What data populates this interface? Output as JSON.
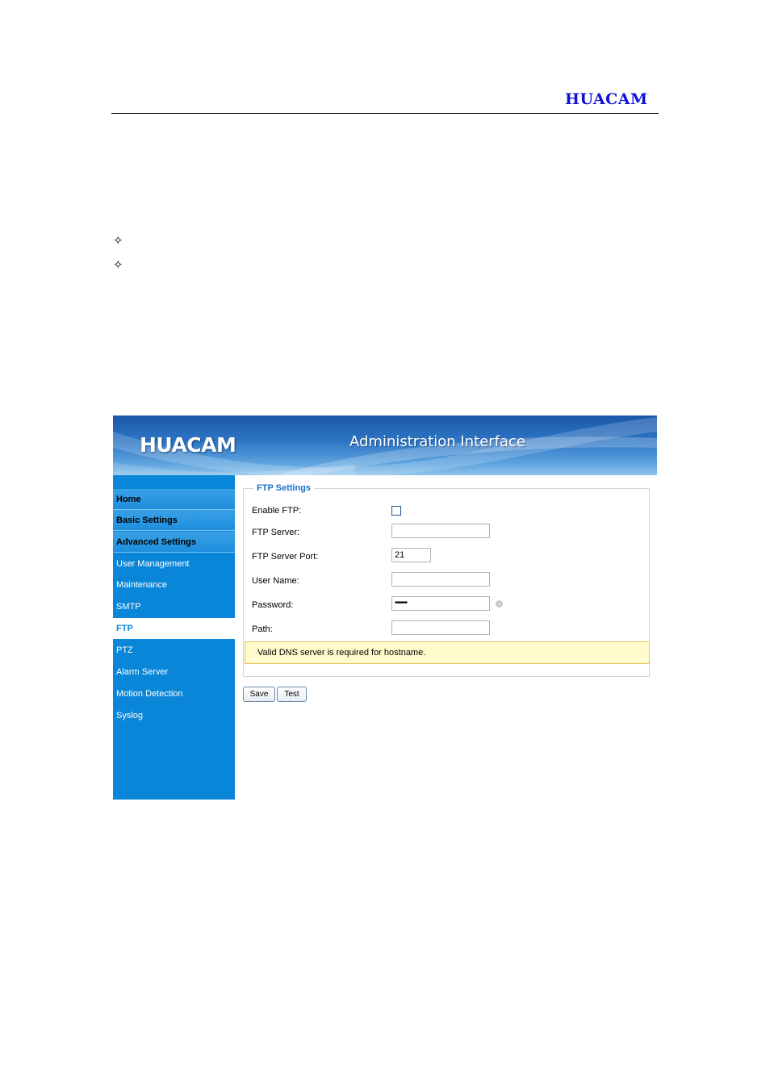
{
  "document": {
    "logo": "HUACAM",
    "bullets": [
      "✧",
      "✧"
    ]
  },
  "banner": {
    "brand": "HUACAM",
    "title": "Administration Interface"
  },
  "sidebar": {
    "items": [
      {
        "label": "Home"
      },
      {
        "label": "Basic Settings"
      },
      {
        "label": "Advanced Settings"
      },
      {
        "label": "User Management"
      },
      {
        "label": "Maintenance"
      },
      {
        "label": "SMTP"
      },
      {
        "label": "FTP"
      },
      {
        "label": "PTZ"
      },
      {
        "label": "Alarm Server"
      },
      {
        "label": "Motion Detection"
      },
      {
        "label": "Syslog"
      }
    ]
  },
  "ftp": {
    "legend": "FTP Settings",
    "enable_label": "Enable FTP:",
    "enable_checked": false,
    "server_label": "FTP Server:",
    "server_value": "",
    "port_label": "FTP Server Port:",
    "port_value": "21",
    "username_label": "User Name:",
    "username_value": "",
    "password_label": "Password:",
    "password_value": "••••••",
    "path_label": "Path:",
    "path_value": "",
    "alert": "Valid DNS server is required for hostname."
  },
  "actions": {
    "save_label": "Save",
    "test_label": "Test"
  },
  "colors": {
    "sidebar": "#0a86d8",
    "accent": "#1a72c4",
    "logo": "#1010d8",
    "alert_bg": "#fffbcc",
    "alert_border": "#e8c25a"
  }
}
